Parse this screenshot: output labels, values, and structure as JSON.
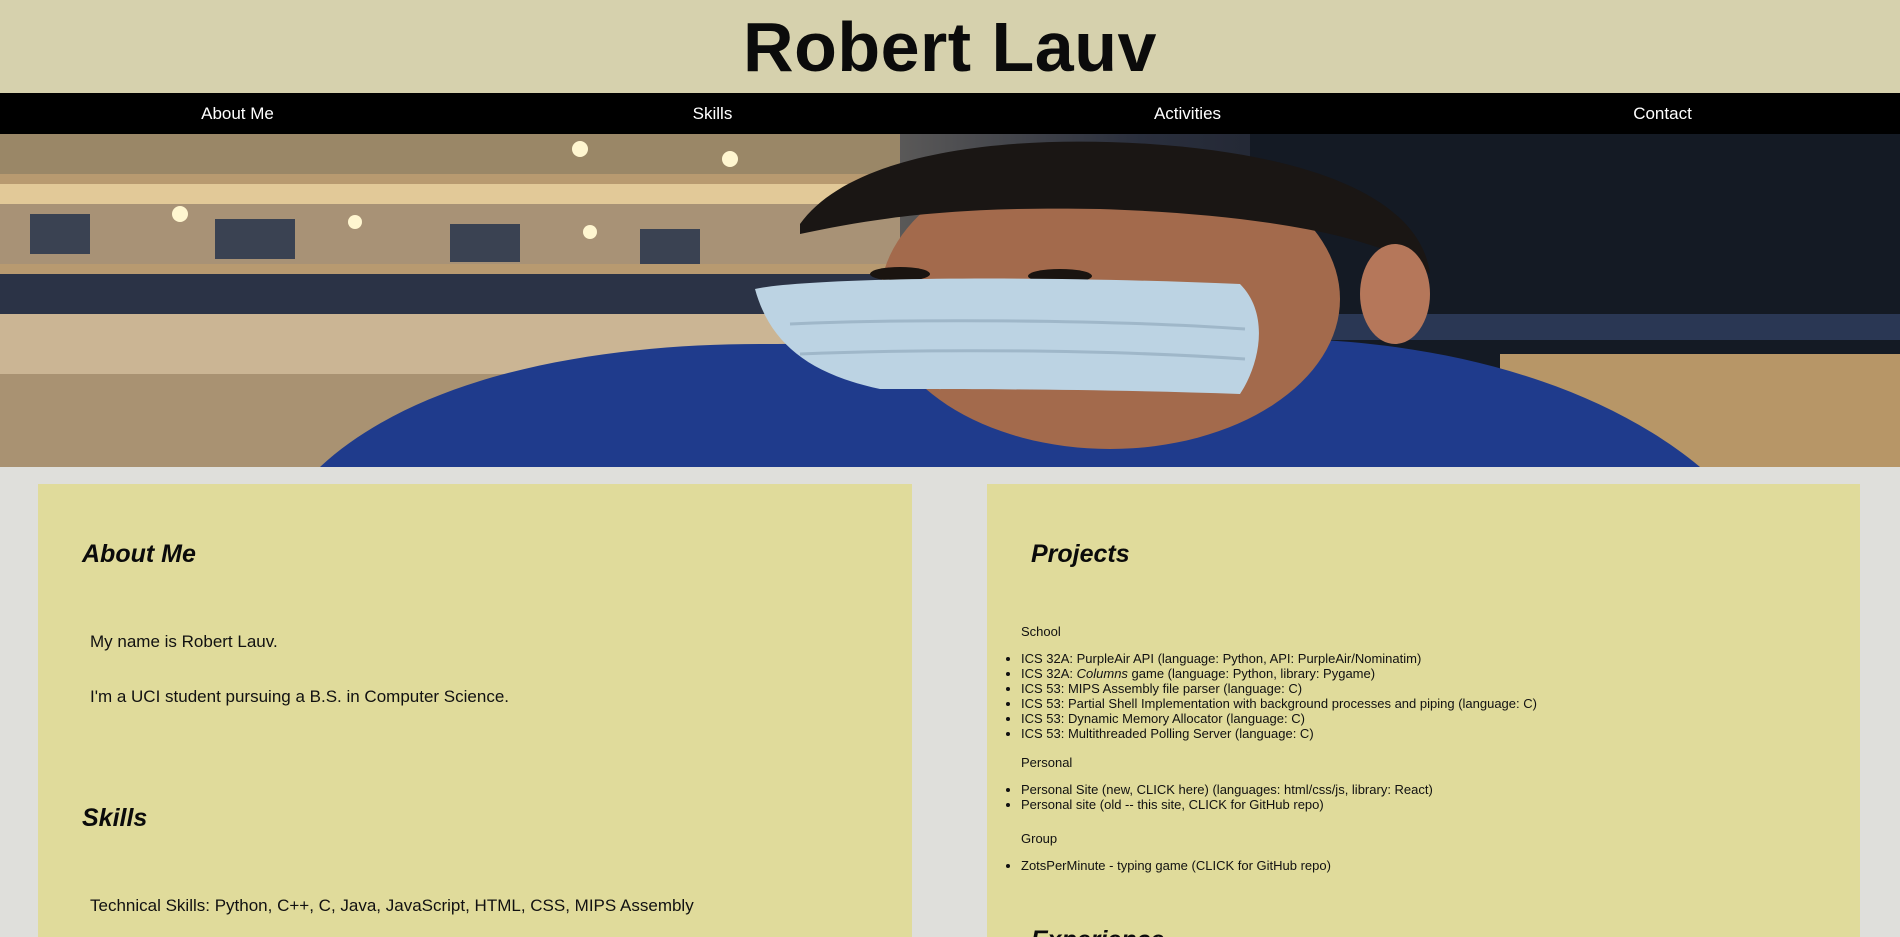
{
  "header": {
    "title": "Robert Lauv"
  },
  "nav": {
    "items": [
      {
        "label": "About Me"
      },
      {
        "label": "Skills"
      },
      {
        "label": "Activities"
      },
      {
        "label": "Contact"
      }
    ]
  },
  "hero": {
    "image": "portrait-photo"
  },
  "about": {
    "heading": "About Me",
    "line1": "My name is Robert Lauv.",
    "line2": "I'm a UCI student pursuing a B.S. in Computer Science."
  },
  "skills": {
    "heading": "Skills",
    "technical": "Technical Skills: Python, C++, C, Java, JavaScript, HTML, CSS, MIPS Assembly"
  },
  "projects": {
    "heading": "Projects",
    "school_label": "School",
    "school_items": [
      "ICS 32A: PurpleAir API (language: Python, API: PurpleAir/Nominatim)",
      "ICS 53: MIPS Assembly file parser (language: C)",
      "ICS 53: Partial Shell Implementation with background processes and piping (language: C)",
      "ICS 53: Dynamic Memory Allocator (language: C)",
      "ICS 53: Multithreaded Polling Server (language: C)"
    ],
    "columns_item": {
      "prefix": "ICS 32A: ",
      "emph": "Columns",
      "suffix": " game (language: Python, library: Pygame)"
    },
    "personal_label": "Personal",
    "personal_items": [
      "Personal Site (new, CLICK here) (languages: html/css/js, library: React)",
      "Personal site (old -- this site, CLICK for GitHub repo)"
    ],
    "group_label": "Group",
    "group_items": [
      "ZotsPerMinute - typing game (CLICK for GitHub repo)"
    ]
  },
  "experience": {
    "heading": "Experience"
  }
}
